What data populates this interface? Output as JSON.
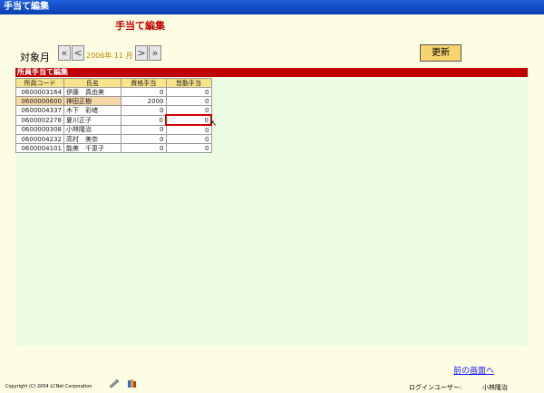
{
  "window": {
    "title": "手当て編集"
  },
  "page": {
    "title": "手当て編集"
  },
  "month_selector": {
    "label": "対象月",
    "first": "«",
    "prev": "<",
    "value": "2006年 11 月",
    "next": ">",
    "last": "»"
  },
  "update_button": "更新",
  "section_title": "所員手当て編集",
  "table": {
    "headers": [
      "所員コード",
      "氏名",
      "資格手当",
      "皆勤手当"
    ],
    "rows": [
      {
        "code": "0600003164",
        "name": "伊藤　真由美",
        "shikaku": "0",
        "kaikin": "0"
      },
      {
        "code": "0600000600",
        "name": "神田正樹",
        "shikaku": "2000",
        "kaikin": "0"
      },
      {
        "code": "0600004337",
        "name": "木下　彩绪",
        "shikaku": "0",
        "kaikin": "0"
      },
      {
        "code": "0600002278",
        "name": "夏川正子",
        "shikaku": "0",
        "kaikin": "0"
      },
      {
        "code": "0600000308",
        "name": "小林隆治",
        "shikaku": "0",
        "kaikin": "0"
      },
      {
        "code": "0600004232",
        "name": "高村　美奈",
        "shikaku": "0",
        "kaikin": "0"
      },
      {
        "code": "0600004101",
        "name": "能美　千恵子",
        "shikaku": "0",
        "kaikin": "0"
      }
    ]
  },
  "footer": {
    "prev_link": "前の画面へ",
    "copyright": "Copyright (C) 2004 LCNet Corporation",
    "login_label": "ログインユーザー:",
    "login_user": "小林隆治"
  },
  "colors": {
    "titlebar": "#0a3fb5",
    "accent": "#c00000",
    "button": "#f7d36e",
    "background": "#fdfde3"
  }
}
